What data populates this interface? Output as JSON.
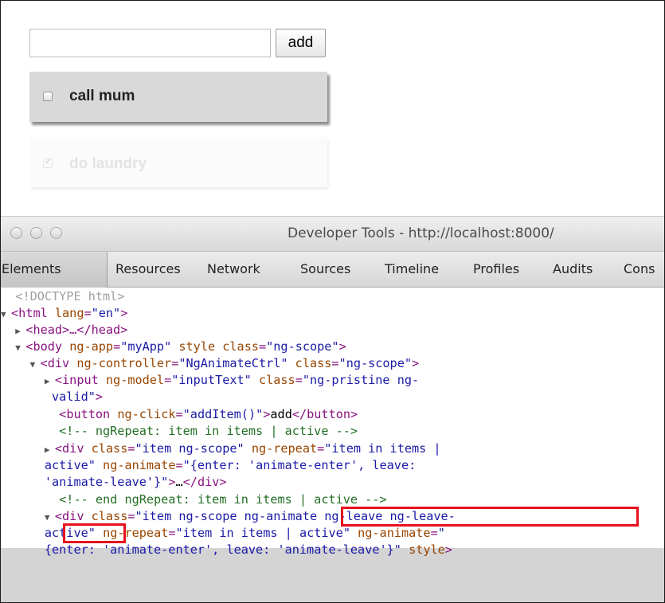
{
  "app": {
    "input_value": "",
    "add_label": "add",
    "items": [
      {
        "label": "call mum",
        "checked": false
      },
      {
        "label": "do laundry",
        "checked": true
      }
    ]
  },
  "devtools": {
    "window_title": "Developer Tools - http://localhost:8000/",
    "tabs": [
      "Elements",
      "Resources",
      "Network",
      "Sources",
      "Timeline",
      "Profiles",
      "Audits",
      "Cons"
    ],
    "active_tab": "Elements",
    "dom": {
      "doctype": "<!DOCTYPE html>",
      "html_tag": "html",
      "lang_attr": "lang",
      "lang_val": "\"en\"",
      "head": "<head>…</head>",
      "body_tag": "body",
      "ngapp_attr": "ng-app",
      "ngapp_val": "\"myApp\"",
      "style_attr": "style",
      "class_attr": "class",
      "body_class_val": "\"ng-scope\"",
      "div_tag": "div",
      "ngctrl_attr": "ng-controller",
      "ngctrl_val": "\"NgAnimateCtrl\"",
      "div_class_val": "\"ng-scope\"",
      "input_tag": "input",
      "ngmodel_attr": "ng-model",
      "ngmodel_val": "\"inputText\"",
      "input_class_val_1": "\"ng-pristine ng-",
      "input_class_val_2": "valid\"",
      "button_tag": "button",
      "ngclick_attr": "ng-click",
      "ngclick_val": "\"addItem()\"",
      "button_text": "add",
      "comment_1": "<!-- ngRepeat: item in items | active -->",
      "item_class_val": "\"item ng-scope\"",
      "ngrepeat_attr": "ng-repeat",
      "ngrepeat_val_1": "\"item in items |",
      "ngrepeat_val_2": "active\"",
      "nganimate_attr": "ng-animate",
      "nganimate_val_1": "\"{enter: 'animate-enter', leave:",
      "nganimate_val_2": "'animate-leave'}\"",
      "collapsed": "…",
      "comment_2": "<!-- end ngRepeat: item in items | active -->",
      "sel_class_val_1": "\"item ng-scope ",
      "sel_class_hl_1": "ng-animate ng-leave ng-leave-",
      "sel_class_hl_2": "active",
      "sel_class_val_2": "\"",
      "sel_ngrepeat_val": "\"item in items | active\"",
      "sel_nganimate_val_1": "\"",
      "sel_nganimate_val_2": "{enter: 'animate-enter', leave: 'animate-leave'}\""
    }
  }
}
